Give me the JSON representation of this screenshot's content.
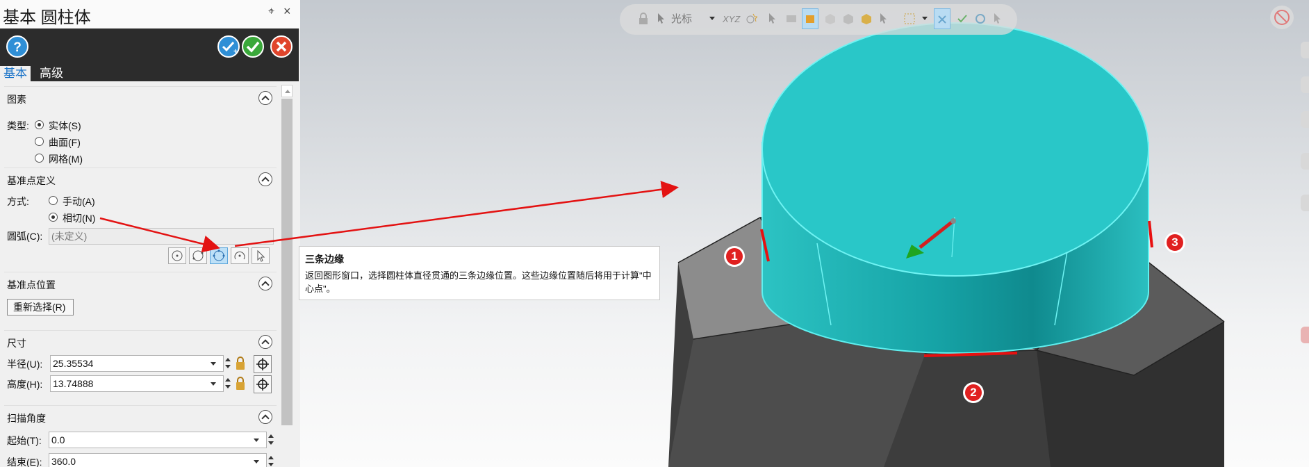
{
  "panel": {
    "title": "基本 圆柱体",
    "pin_glyph": "ᴾ",
    "close_glyph": "×",
    "toolbar": {
      "help_icon": "help-icon",
      "apply_icon": "apply-icon",
      "ok_icon": "ok-icon",
      "cancel_icon": "cancel-icon"
    },
    "tabs": [
      {
        "label": "基本",
        "active": true
      },
      {
        "label": "高级",
        "active": false
      }
    ],
    "sections": {
      "entity": {
        "title": "图素",
        "type_label": "类型:",
        "options": [
          {
            "label": "实体(S)",
            "checked": true
          },
          {
            "label": "曲面(F)",
            "checked": false
          },
          {
            "label": "网格(M)",
            "checked": false
          }
        ]
      },
      "base_point_def": {
        "title": "基准点定义",
        "method_label": "方式:",
        "options": [
          {
            "label": "手动(A)",
            "checked": false
          },
          {
            "label": "相切(N)",
            "checked": true
          }
        ],
        "arc_label": "圆弧(C):",
        "arc_value": "(未定义)"
      },
      "base_point_pos": {
        "title": "基准点位置",
        "reselect_button": "重新选择(R)"
      },
      "size": {
        "title": "尺寸",
        "radius_label": "半径(U):",
        "radius_value": "25.35534",
        "height_label": "高度(H):",
        "height_value": "13.74888"
      },
      "sweep": {
        "title": "扫描角度",
        "start_label": "起始(T):",
        "start_value": "0.0",
        "end_label": "结束(E):",
        "end_value": "360.0"
      }
    }
  },
  "viewport": {
    "toolbar_text": "光标",
    "toolbar_xyz": "XYZ",
    "tooltip": {
      "title": "三条边缘",
      "body": "返回图形窗口，选择圆柱体直径贯通的三条边缘位置。这些边缘位置随后将用于计算\"中心点\"。"
    },
    "markers": [
      "1",
      "2",
      "3"
    ],
    "colors": {
      "cylinder_top": "#2bc6c6",
      "cylinder_side": "#1aa9ad",
      "prism_dark": "#4a4a4a",
      "prism_light": "#9a9a9a",
      "highlight": "#e81010"
    }
  }
}
